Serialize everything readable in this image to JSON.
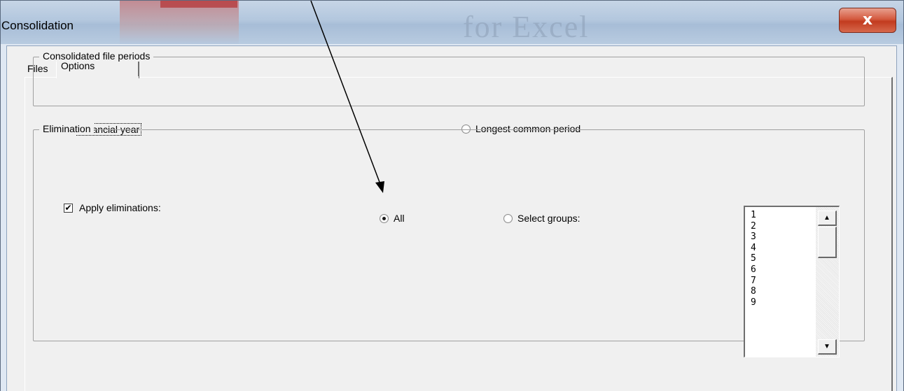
{
  "window": {
    "title": "Consolidation",
    "watermark": "for Excel",
    "close_label": "x"
  },
  "tabs": [
    {
      "label": "Files",
      "selected": false
    },
    {
      "label": "Options",
      "selected": true
    }
  ],
  "periods_group": {
    "legend": "Consolidated file periods",
    "options": [
      {
        "label": "Financial year",
        "checked": true
      },
      {
        "label": "Longest common period",
        "checked": false
      }
    ]
  },
  "elimination_group": {
    "legend": "Elimination",
    "apply_label": "Apply eliminations:",
    "apply_checked": true,
    "check_glyph": "✔",
    "scope_options": [
      {
        "label": "All",
        "checked": true
      },
      {
        "label": "Select groups:",
        "checked": false
      }
    ],
    "groups_list": [
      "1",
      "2",
      "3",
      "4",
      "5",
      "6",
      "7",
      "8",
      "9"
    ],
    "scroll_up_glyph": "▲",
    "scroll_down_glyph": "▼"
  },
  "colors": {
    "close_button": "#c23b1f",
    "dialog_background": "#f0f0f0",
    "title_bar": "#b3c7de"
  }
}
